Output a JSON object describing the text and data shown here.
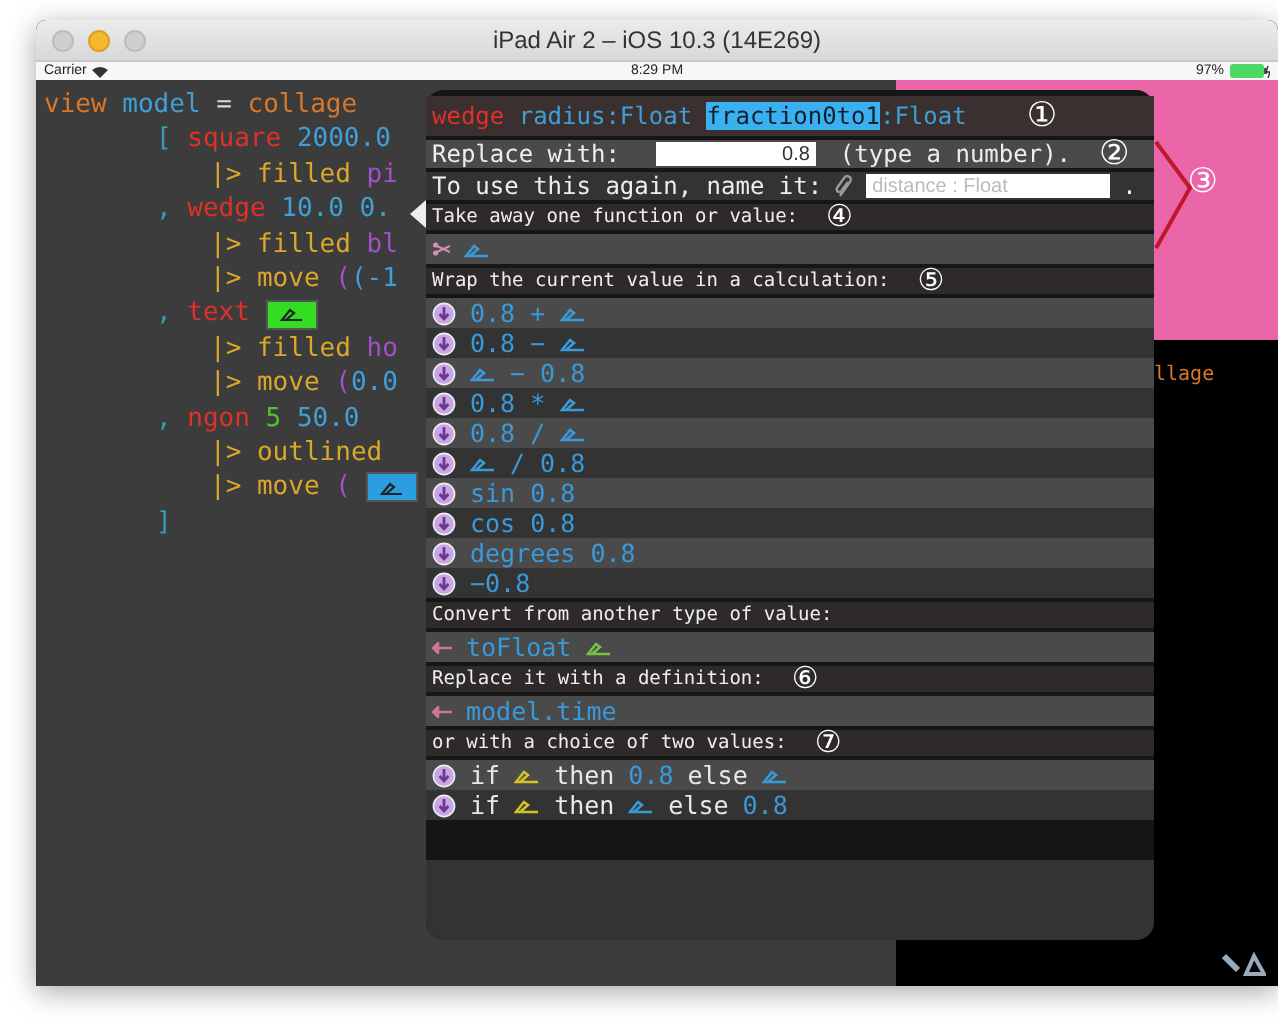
{
  "window": {
    "title": "iPad Air 2 – iOS 10.3 (14E269)"
  },
  "status_bar": {
    "carrier": "Carrier",
    "time": "8:29 PM",
    "battery": "97%"
  },
  "code": {
    "lines": [
      {
        "kind": "head",
        "tokens": [
          {
            "t": "view ",
            "kind": "keyword"
          },
          {
            "t": "model ",
            "kind": "name"
          },
          {
            "t": "= ",
            "kind": "plain"
          },
          {
            "t": "collage",
            "kind": "keyword"
          }
        ]
      },
      {
        "kind": "item",
        "tokens": [
          {
            "t": "[ ",
            "kind": "punct"
          },
          {
            "t": "square ",
            "kind": "func"
          },
          {
            "t": "2000.0",
            "kind": "number"
          }
        ]
      },
      {
        "kind": "pipe",
        "tokens": [
          {
            "t": "|> filled ",
            "kind": "op"
          },
          {
            "t": "pi",
            "kind": "value"
          }
        ]
      },
      {
        "kind": "item",
        "tokens": [
          {
            "t": ", ",
            "kind": "punct"
          },
          {
            "t": "wedge ",
            "kind": "func"
          },
          {
            "t": "10.0 0.",
            "kind": "number"
          }
        ]
      },
      {
        "kind": "pipe",
        "tokens": [
          {
            "t": "|> filled ",
            "kind": "op"
          },
          {
            "t": "bl",
            "kind": "value"
          }
        ]
      },
      {
        "kind": "pipe",
        "tokens": [
          {
            "t": "|> move ",
            "kind": "op"
          },
          {
            "t": "(",
            "kind": "value"
          },
          {
            "t": "(-1",
            "kind": "number"
          }
        ]
      },
      {
        "kind": "item",
        "tokens": [
          {
            "t": ", ",
            "kind": "punct"
          },
          {
            "t": "text ",
            "kind": "func"
          },
          {
            "kind": "hole",
            "color": "#33dd22"
          }
        ]
      },
      {
        "kind": "pipe",
        "tokens": [
          {
            "t": "|> filled ",
            "kind": "op"
          },
          {
            "t": "ho",
            "kind": "value"
          }
        ]
      },
      {
        "kind": "pipe",
        "tokens": [
          {
            "t": "|> move ",
            "kind": "op"
          },
          {
            "t": "(",
            "kind": "value"
          },
          {
            "t": "0.0",
            "kind": "number"
          }
        ]
      },
      {
        "kind": "item",
        "tokens": [
          {
            "t": ", ",
            "kind": "punct"
          },
          {
            "t": "ngon ",
            "kind": "func"
          },
          {
            "t": "5 ",
            "kind": "int"
          },
          {
            "t": "50.0",
            "kind": "number"
          }
        ]
      },
      {
        "kind": "pipe",
        "tokens": [
          {
            "t": "|> outlined",
            "kind": "op"
          }
        ]
      },
      {
        "kind": "pipe",
        "tokens": [
          {
            "t": "|> move ",
            "kind": "op"
          },
          {
            "t": "( ",
            "kind": "value"
          },
          {
            "kind": "hole",
            "color": "#2a9ee0"
          }
        ]
      },
      {
        "kind": "close",
        "tokens": [
          {
            "t": "]",
            "kind": "punct"
          }
        ]
      }
    ]
  },
  "canvas": {
    "text": "llage"
  },
  "popup": {
    "header": {
      "badge": "①",
      "parts": [
        {
          "t": "wedge ",
          "kind": "func",
          "selected": false
        },
        {
          "t": "radius:Float ",
          "kind": "name",
          "selected": false
        },
        {
          "t": "fraction0to1",
          "kind": "name",
          "selected": true
        },
        {
          "t": ":Float",
          "kind": "name",
          "selected": false
        }
      ]
    },
    "replace": {
      "label": "Replace with:",
      "value": "0.8",
      "hint": "(type a number).",
      "badge": "②"
    },
    "name": {
      "label": "To use this again, name it:",
      "placeholder": "distance : Float",
      "end": ".",
      "badge": "③"
    },
    "sections": [
      {
        "label": "Take away one function or value:",
        "badge": "④",
        "rows": [
          {
            "kind": "remove",
            "parts": [
              {
                "kind": "hole",
                "color": "#3a9ad9"
              }
            ]
          }
        ]
      },
      {
        "label": "Wrap the current value in a calculation:",
        "badge": "⑤",
        "rows": [
          {
            "kind": "option",
            "parts": [
              {
                "t": "0.8 +",
                "kind": "code"
              },
              {
                "kind": "hole",
                "color": "#3a9ad9"
              }
            ]
          },
          {
            "kind": "option",
            "parts": [
              {
                "t": "0.8 −",
                "kind": "code"
              },
              {
                "kind": "hole",
                "color": "#3a9ad9"
              }
            ]
          },
          {
            "kind": "option",
            "parts": [
              {
                "kind": "hole",
                "color": "#3a9ad9"
              },
              {
                "t": "− 0.8",
                "kind": "code"
              }
            ]
          },
          {
            "kind": "option",
            "parts": [
              {
                "t": "0.8 *",
                "kind": "code"
              },
              {
                "kind": "hole",
                "color": "#3a9ad9"
              }
            ]
          },
          {
            "kind": "option",
            "parts": [
              {
                "t": "0.8 /",
                "kind": "code"
              },
              {
                "kind": "hole",
                "color": "#3a9ad9"
              }
            ]
          },
          {
            "kind": "option",
            "parts": [
              {
                "kind": "hole",
                "color": "#3a9ad9"
              },
              {
                "t": "/ 0.8",
                "kind": "code"
              }
            ]
          },
          {
            "kind": "option",
            "parts": [
              {
                "t": "sin 0.8",
                "kind": "code"
              }
            ]
          },
          {
            "kind": "option",
            "parts": [
              {
                "t": "cos 0.8",
                "kind": "code"
              }
            ]
          },
          {
            "kind": "option",
            "parts": [
              {
                "t": "degrees 0.8",
                "kind": "code"
              }
            ]
          },
          {
            "kind": "option",
            "parts": [
              {
                "t": "−0.8",
                "kind": "code"
              }
            ]
          }
        ]
      },
      {
        "label": "Convert from another type of value:",
        "rows": [
          {
            "kind": "link",
            "parts": [
              {
                "t": "toFloat",
                "kind": "code"
              },
              {
                "kind": "hole",
                "color": "#7ac143"
              }
            ]
          }
        ]
      },
      {
        "label": "Replace it with a definition:",
        "badge": "⑥",
        "rows": [
          {
            "kind": "link",
            "parts": [
              {
                "t": "model.time",
                "kind": "code"
              }
            ]
          }
        ]
      },
      {
        "label": "or with a choice of two values:",
        "badge": "⑦",
        "rows": [
          {
            "kind": "option",
            "parts": [
              {
                "t": "if",
                "kind": "word"
              },
              {
                "kind": "hole",
                "color": "#d4c22a"
              },
              {
                "t": "then",
                "kind": "word"
              },
              {
                "t": "0.8",
                "kind": "code"
              },
              {
                "t": "else",
                "kind": "word"
              },
              {
                "kind": "hole",
                "color": "#3a9ad9"
              }
            ]
          },
          {
            "kind": "option",
            "parts": [
              {
                "t": "if",
                "kind": "word"
              },
              {
                "kind": "hole",
                "color": "#d4c22a"
              },
              {
                "t": "then",
                "kind": "word"
              },
              {
                "kind": "hole",
                "color": "#3a9ad9"
              },
              {
                "t": "else",
                "kind": "word"
              },
              {
                "t": "0.8",
                "kind": "code"
              }
            ]
          }
        ]
      }
    ]
  }
}
